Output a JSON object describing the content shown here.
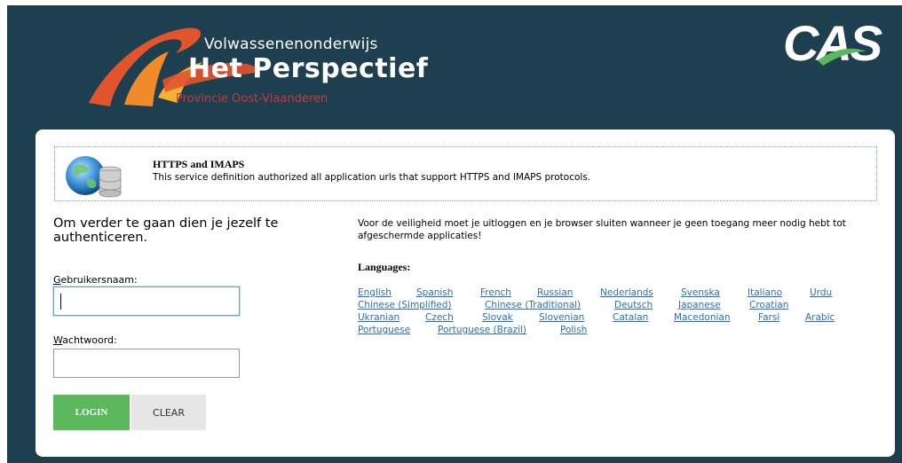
{
  "header": {
    "logo_subtitle": "Volwassenenonderwijs",
    "logo_title": "Het Perspectief",
    "logo_province": "Provincie Oost-Vlaanderen",
    "cas_logo": "CAS"
  },
  "service": {
    "icon": "globe-database-icon",
    "name": "HTTPS and IMAPS",
    "description": "This service definition authorized all application urls that support HTTPS and IMAPS protocols."
  },
  "login": {
    "heading": "Om verder te gaan dien je jezelf te authenticeren.",
    "username_label": "Gebruikersnaam:",
    "username_value": "",
    "password_label": "Wachtwoord:",
    "password_value": "",
    "login_button": "LOGIN",
    "clear_button": "CLEAR"
  },
  "info": {
    "security_note": "Voor de veiligheid moet je uitloggen en je browser sluiten wanneer je geen toegang meer nodig hebt tot afgeschermde applicaties!",
    "languages_heading": "Languages:",
    "languages": [
      [
        "English",
        "Spanish",
        "French",
        "Russian",
        "Nederlands",
        "Svenska",
        "Italiano",
        "Urdu"
      ],
      [
        "Chinese (Simplified)",
        "Chinese (Traditional)",
        "Deutsch",
        "Japanese",
        "Croatian"
      ],
      [
        "Ukranian",
        "Czech",
        "Slovak",
        "Slovenian",
        "Catalan",
        "Macedonian",
        "Farsi",
        "Arabic"
      ],
      [
        "Portuguese",
        "Portuguese (Brazil)",
        "Polish"
      ]
    ]
  },
  "colors": {
    "header_bg": "#1e3f4f",
    "login_button": "#5cb85c",
    "clear_button": "#e6e6e6",
    "link": "#2a6fb0",
    "logo_red": "#c43a3a"
  }
}
